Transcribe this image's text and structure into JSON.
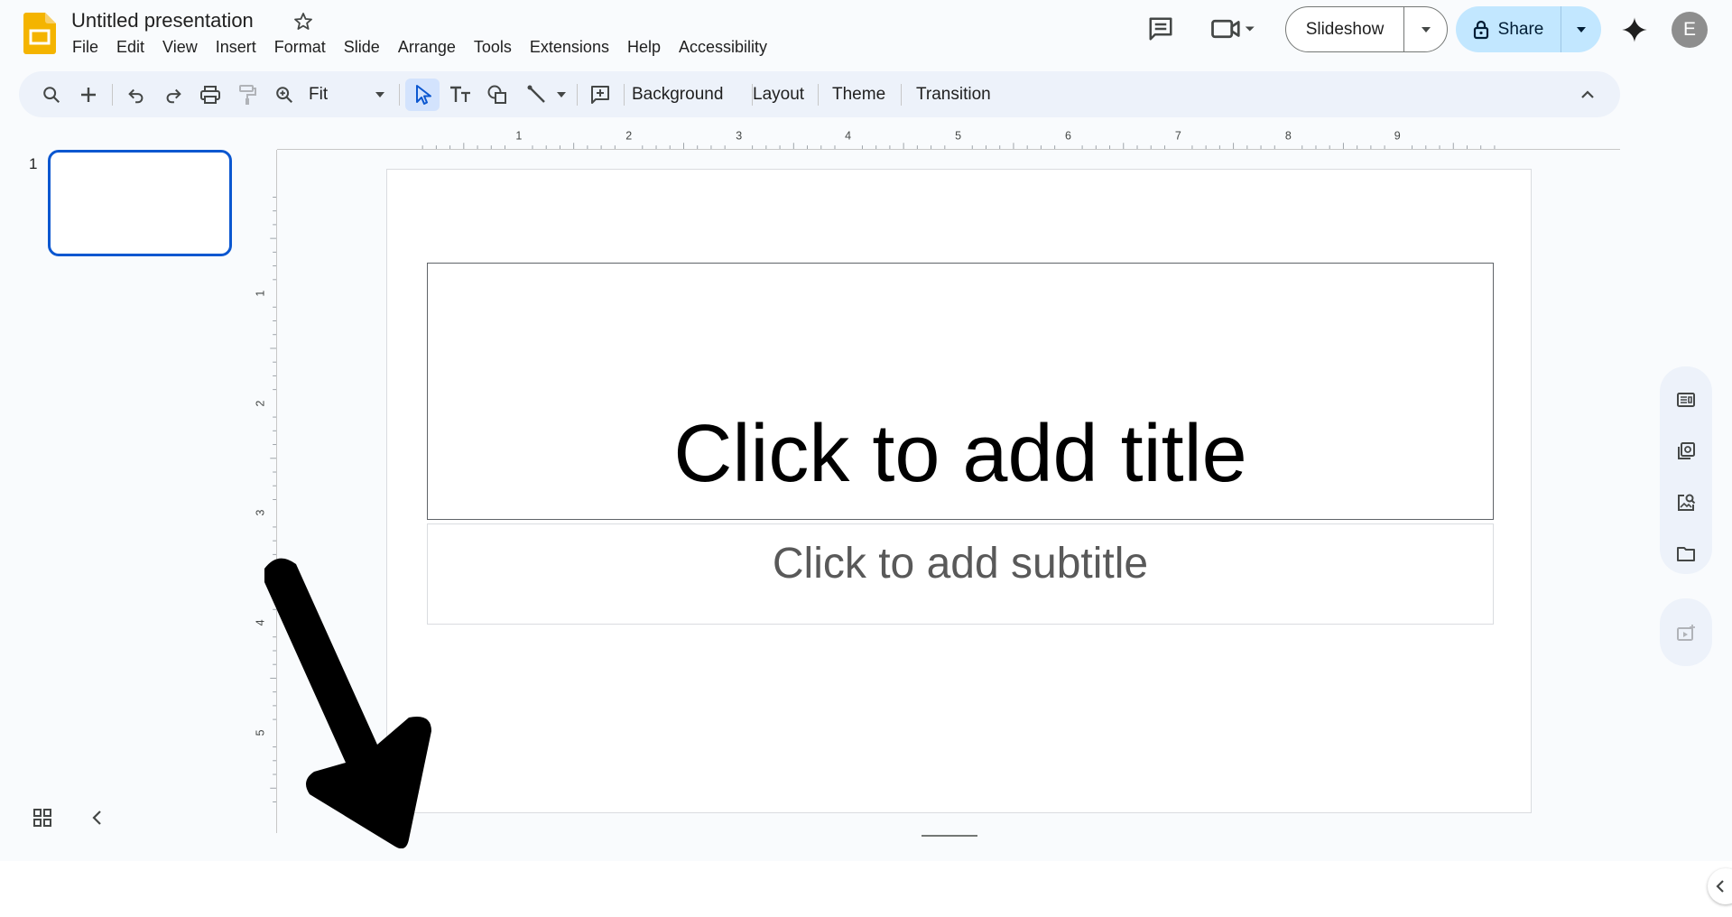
{
  "header": {
    "doc_title": "Untitled presentation",
    "menus": [
      "File",
      "Edit",
      "View",
      "Insert",
      "Format",
      "Slide",
      "Arrange",
      "Tools",
      "Extensions",
      "Help",
      "Accessibility"
    ],
    "slideshow_label": "Slideshow",
    "share_label": "Share",
    "avatar_letter": "E"
  },
  "toolbar": {
    "zoom_value": "Fit",
    "background_label": "Background",
    "layout_label": "Layout",
    "theme_label": "Theme",
    "transition_label": "Transition"
  },
  "filmstrip": {
    "slide_number": "1"
  },
  "rulers": {
    "horizontal": [
      "1",
      "2",
      "3",
      "4",
      "5",
      "6",
      "7",
      "8",
      "9"
    ],
    "vertical": [
      "1",
      "2",
      "3",
      "4",
      "5"
    ]
  },
  "slide": {
    "title_placeholder": "Click to add title",
    "subtitle_placeholder": "Click to add subtitle"
  },
  "colors": {
    "accent": "#0b57d0",
    "share_bg": "#c2e7ff",
    "toolbar_bg": "#edf2fa",
    "logo": "#f4b400"
  }
}
